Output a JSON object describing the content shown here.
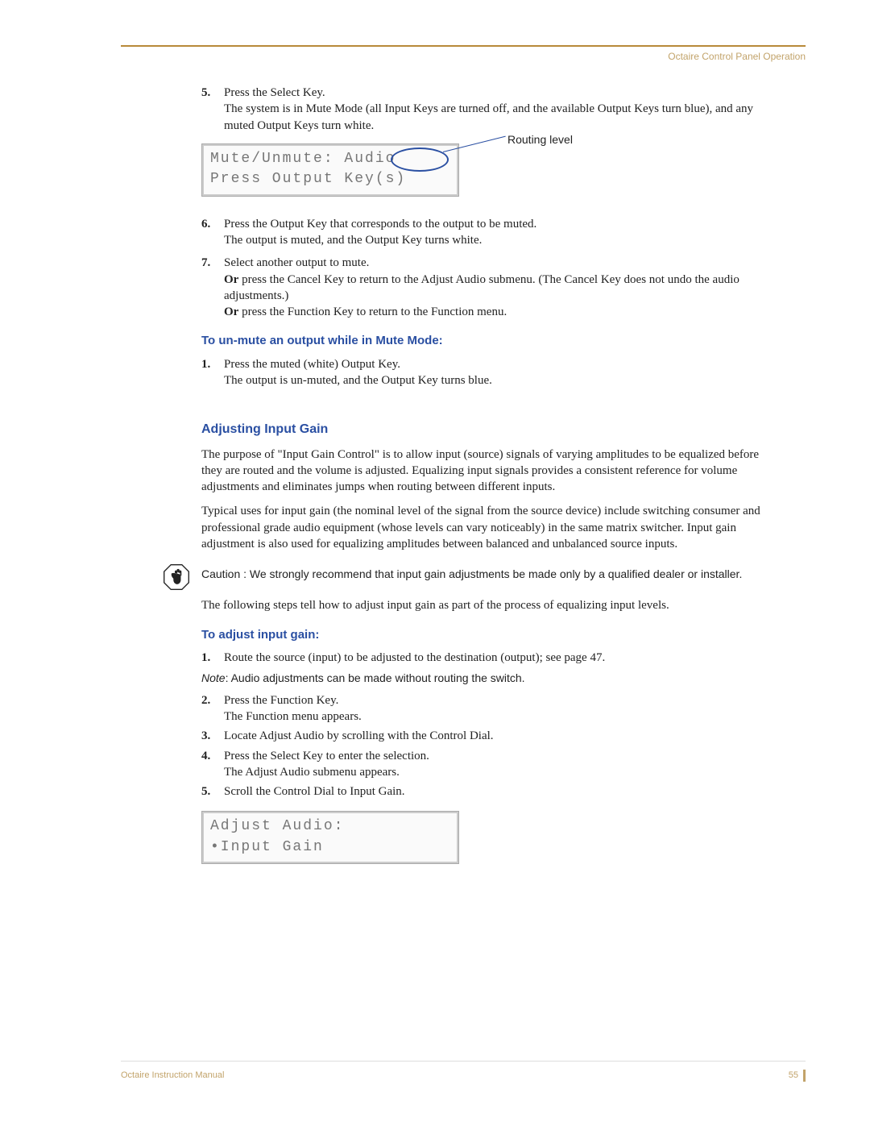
{
  "header": {
    "title": "Octaire Control Panel Operation"
  },
  "step5": {
    "num": "5.",
    "line1": "Press the Select Key.",
    "line2": "The system is in Mute Mode (all Input Keys are turned off, and the available Output Keys turn blue), and any muted Output Keys turn white."
  },
  "lcd1": {
    "line1": "Mute/Unmute:  Audio",
    "line2": "Press Output Key(s)",
    "callout": "Routing level"
  },
  "step6": {
    "num": "6.",
    "line1": "Press the Output Key that corresponds to the output to be muted.",
    "line2": "The output is muted, and the Output Key turns white."
  },
  "step7": {
    "num": "7.",
    "line1": "Select another output to mute.",
    "or1a": "Or",
    "or1b": " press the Cancel Key to return to the Adjust Audio submenu. (The Cancel Key does not undo the audio adjustments.)",
    "or2a": "Or",
    "or2b": " press the Function Key to return to the Function menu."
  },
  "unmute": {
    "head": "To un-mute an output while in Mute Mode:",
    "num": "1.",
    "line1": "Press the muted (white) Output Key.",
    "line2": "The output is un-muted, and the Output Key turns blue."
  },
  "gain": {
    "head": "Adjusting Input Gain",
    "p1": "The purpose of \"Input Gain Control\" is to allow input (source) signals of varying amplitudes to be equalized before they are routed and the volume is adjusted. Equalizing input signals provides a consistent reference for volume adjustments and eliminates jumps when routing between different inputs.",
    "p2": "Typical uses for input gain (the nominal level of the signal from the source device) include switching consumer and professional grade audio equipment (whose levels can vary noticeably) in the same matrix switcher. Input gain adjustment is also used for equalizing amplitudes between balanced and unbalanced source inputs.",
    "caution": "Caution : We strongly recommend that input gain adjustments be made only by a qualified dealer or installer.",
    "p3": "The following steps tell how to adjust input gain as part of the process of equalizing input levels."
  },
  "adjust": {
    "head": "To adjust input gain:",
    "s1n": "1.",
    "s1": "Route the source (input) to be adjusted to the destination (output); see page 47.",
    "note_label": "Note",
    "note_text": ": Audio adjustments can be made without routing the switch.",
    "s2n": "2.",
    "s2a": "Press the Function Key.",
    "s2b": "The Function menu appears.",
    "s3n": "3.",
    "s3": "Locate Adjust Audio by scrolling with the Control Dial.",
    "s4n": "4.",
    "s4a": "Press the Select Key to enter the selection.",
    "s4b": "The Adjust Audio submenu appears.",
    "s5n": "5.",
    "s5": "Scroll the Control Dial to Input Gain."
  },
  "lcd2": {
    "line1": "Adjust Audio:",
    "line2": "•Input Gain"
  },
  "footer": {
    "manual": "Octaire Instruction Manual",
    "page": "55"
  }
}
